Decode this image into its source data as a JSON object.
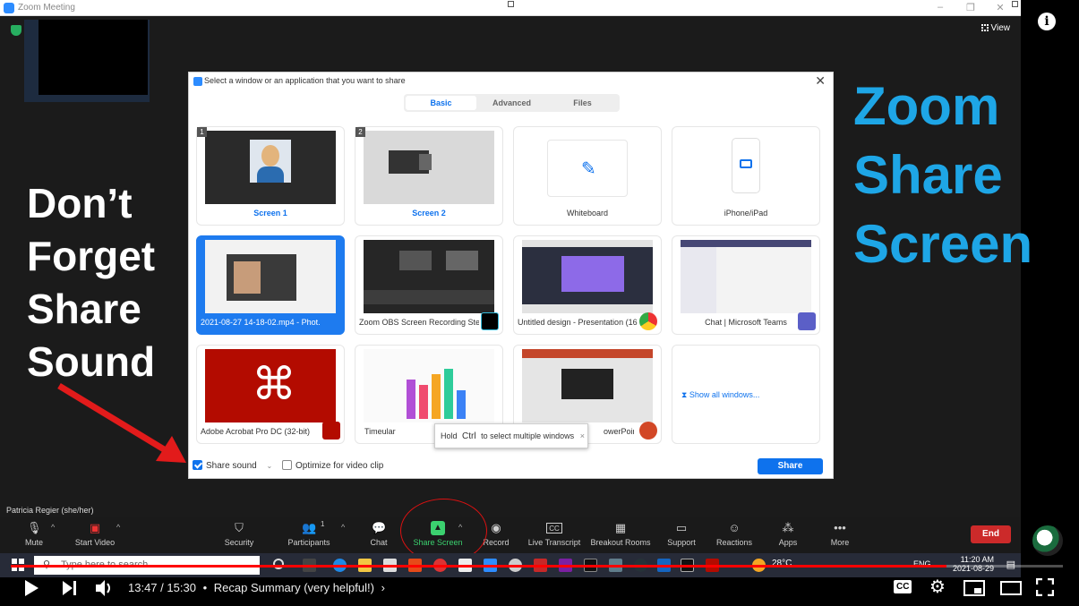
{
  "zoom": {
    "window_title": "Zoom Meeting",
    "view_label": "View",
    "participant_name": "Patricia Regier (she/her)"
  },
  "overlay": {
    "left_lines": [
      "Don’t",
      "Forget",
      "Share",
      "Sound"
    ],
    "right_lines": [
      "Zoom",
      "Share",
      "Screen"
    ]
  },
  "dialog": {
    "title": "Select a window or an application that you want to share",
    "tabs": [
      {
        "label": "Basic",
        "active": true
      },
      {
        "label": "Advanced",
        "active": false
      },
      {
        "label": "Files",
        "active": false
      }
    ],
    "cards": [
      {
        "label": "Screen 1",
        "num": "1"
      },
      {
        "label": "Screen 2",
        "num": "2"
      },
      {
        "label": "Whiteboard"
      },
      {
        "label": "iPhone/iPad"
      },
      {
        "label": "2021-08-27 14-18-02.mp4 - Phot..."
      },
      {
        "label": "Zoom OBS Screen Recording Ste..."
      },
      {
        "label": "Untitled design - Presentation (16..."
      },
      {
        "label": "Chat | Microsoft Teams"
      },
      {
        "label": "Adobe Acrobat Pro DC (32-bit)"
      },
      {
        "label": "Timeular"
      },
      {
        "label": "owerPoint"
      },
      {
        "label": "Show all windows..."
      }
    ],
    "tooltip": {
      "pre": "Hold",
      "key": "Ctrl",
      "post": "to select multiple windows",
      "close": "×"
    },
    "share_sound": {
      "label": "Share sound",
      "checked": true
    },
    "optimize": {
      "label": "Optimize for video clip",
      "checked": false
    },
    "share_button": "Share"
  },
  "toolbar": {
    "items": [
      {
        "label": "Mute",
        "icon": "microphone-icon"
      },
      {
        "label": "Start Video",
        "icon": "video-off-icon"
      },
      {
        "label": "Security",
        "icon": "shield-icon"
      },
      {
        "label": "Participants",
        "icon": "participants-icon",
        "count": "1"
      },
      {
        "label": "Chat",
        "icon": "chat-icon"
      },
      {
        "label": "Share Screen",
        "icon": "share-screen-icon"
      },
      {
        "label": "Record",
        "icon": "record-icon"
      },
      {
        "label": "Live Transcript",
        "icon": "cc-icon",
        "glyph": "CC"
      },
      {
        "label": "Breakout Rooms",
        "icon": "breakout-icon"
      },
      {
        "label": "Support",
        "icon": "support-icon"
      },
      {
        "label": "Reactions",
        "icon": "reactions-icon"
      },
      {
        "label": "Apps",
        "icon": "apps-icon"
      },
      {
        "label": "More",
        "icon": "more-icon"
      }
    ],
    "end_label": "End"
  },
  "taskbar": {
    "search_placeholder": "Type here to search",
    "temperature": "28°C",
    "language": "ENG",
    "time": "11:20 AM",
    "date": "2021-08-29"
  },
  "youtube": {
    "current_time": "13:47",
    "duration": "15:30",
    "separator": "/",
    "chapter": "Recap Summary (very helpful!)",
    "progress_fraction": 0.889,
    "cc_glyph": "CC"
  },
  "colors": {
    "zoom_blue": "#0e72ed",
    "overlay_blue": "#1ea6e6",
    "progress_red": "#ff0000",
    "end_red": "#cc2a2a",
    "share_green": "#3bd16f"
  }
}
